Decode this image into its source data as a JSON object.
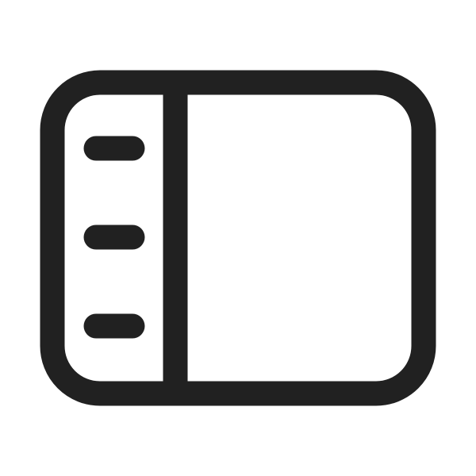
{
  "icon": {
    "name": "sidebar-panel-icon",
    "stroke_color": "#212121",
    "background_color": "#ffffff",
    "sidebar_item_count": 3
  }
}
